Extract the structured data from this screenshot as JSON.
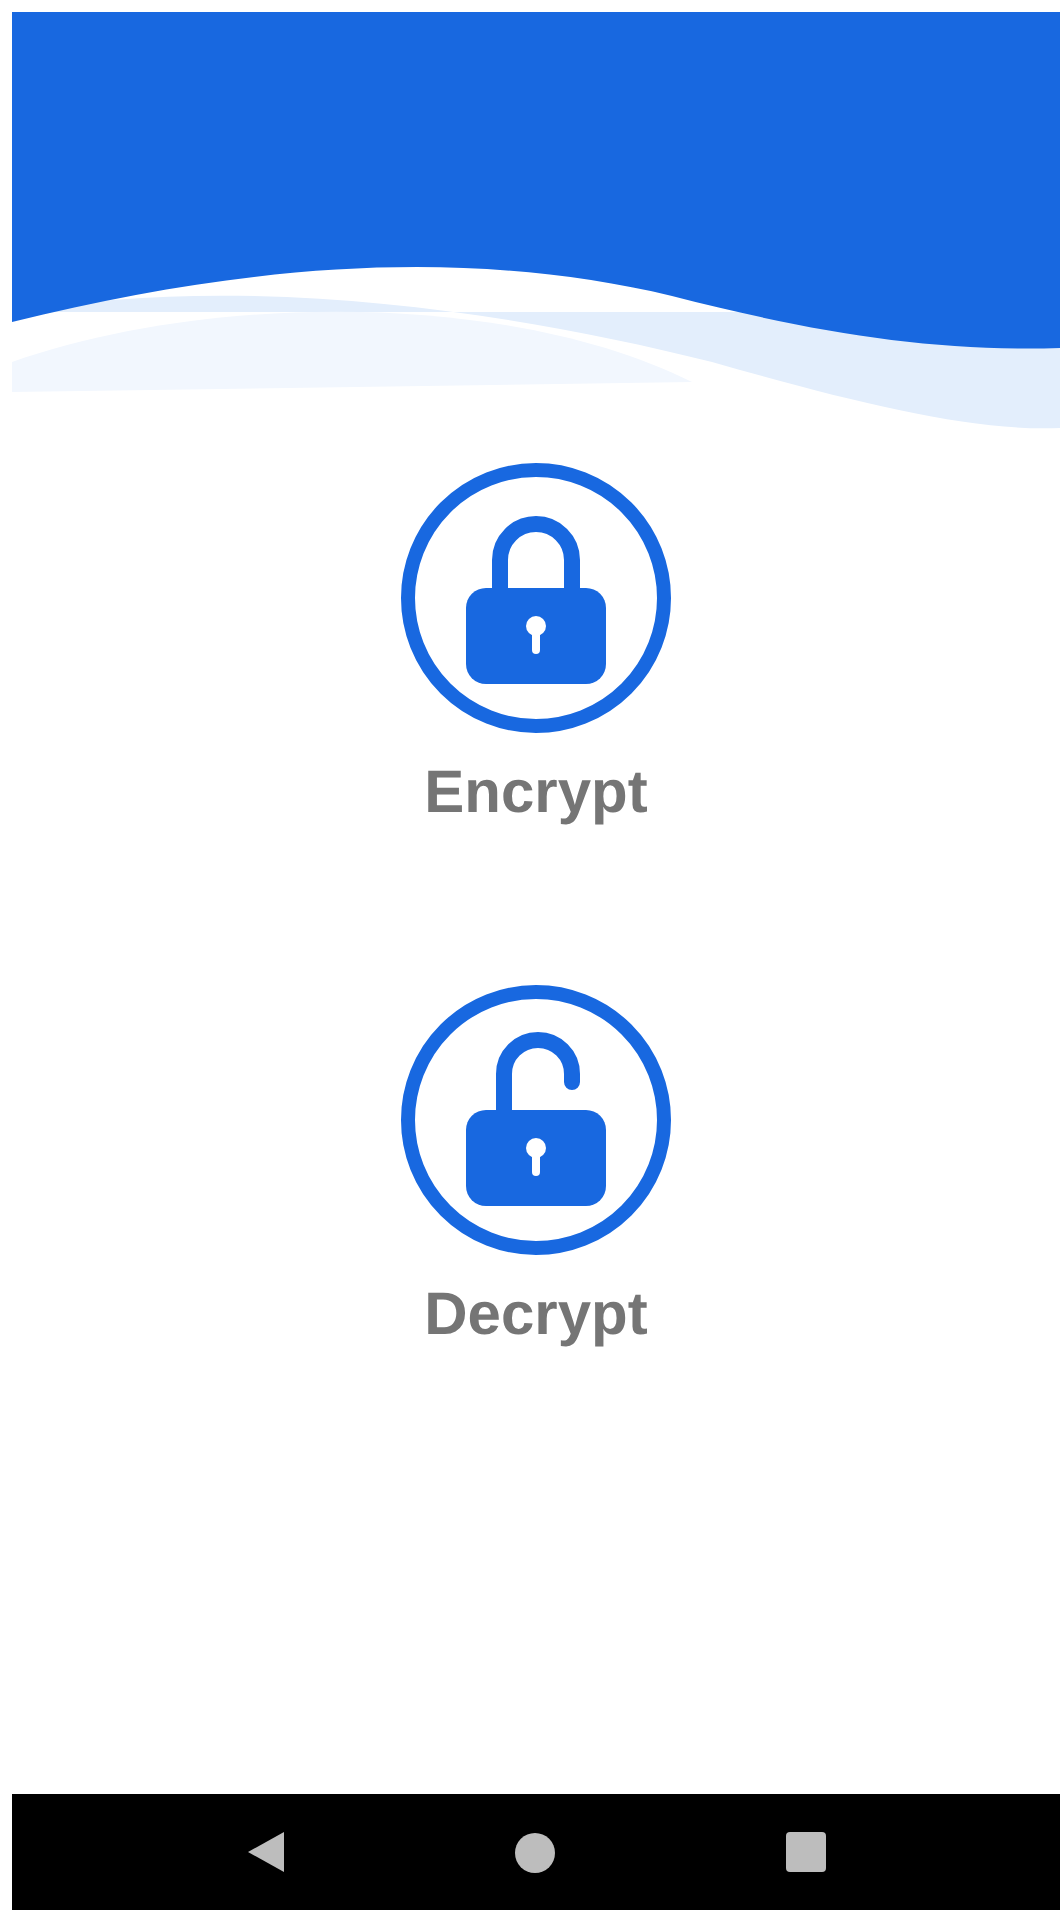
{
  "actions": [
    {
      "kind": "lock",
      "label": "Encrypt"
    },
    {
      "kind": "unlock",
      "label": "Decrypt"
    }
  ]
}
